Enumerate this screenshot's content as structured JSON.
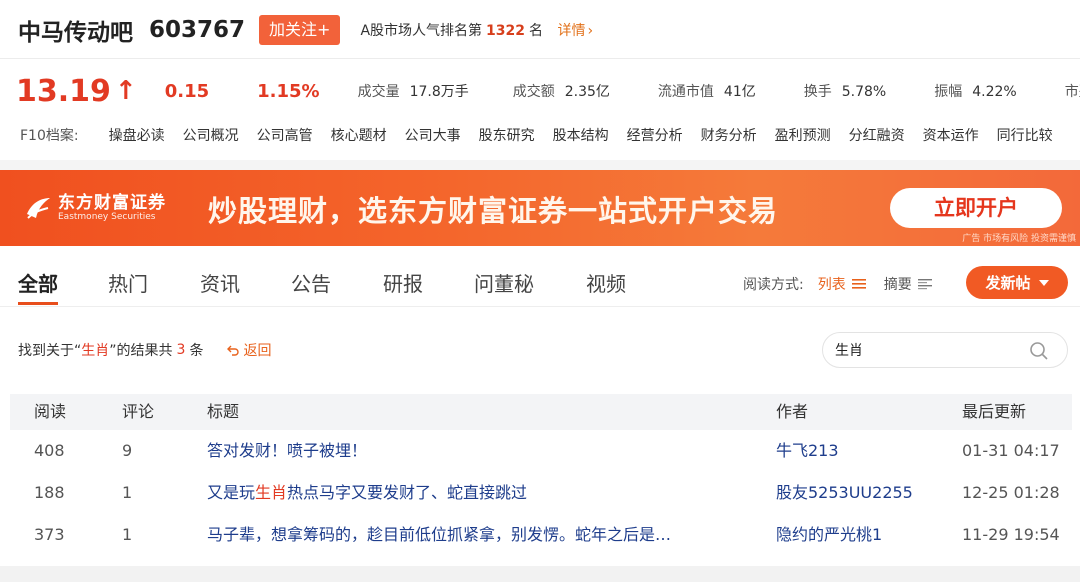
{
  "header": {
    "stock_name": "中马传动吧",
    "stock_code": "603767",
    "follow_label": "加关注+",
    "rank_prefix": "A股市场人气排名第",
    "rank_value": "1322",
    "rank_suffix": "名",
    "detail_label": "详情",
    "detail_icon": "chevron-right-icon"
  },
  "quote": {
    "price": "13.19",
    "direction_icon": "arrow-up-icon",
    "change": "0.15",
    "change_pct": "1.15%",
    "up_color": "#e23a23",
    "stats": [
      {
        "label": "成交量",
        "value": "17.8万手"
      },
      {
        "label": "成交额",
        "value": "2.35亿"
      },
      {
        "label": "流通市值",
        "value": "41亿"
      },
      {
        "label": "换手",
        "value": "5.78%"
      },
      {
        "label": "振幅",
        "value": "4.22%"
      },
      {
        "label": "市盈",
        "value": ""
      }
    ]
  },
  "f10": {
    "label": "F10档案:",
    "items": [
      "操盘必读",
      "公司概况",
      "公司高管",
      "核心题材",
      "公司大事",
      "股东研究",
      "股本结构",
      "经营分析",
      "财务分析",
      "盈利预测",
      "分红融资",
      "资本运作",
      "同行比较"
    ]
  },
  "banner": {
    "logo_cn": "东方财富证券",
    "logo_en": "Eastmoney Securities",
    "slogan": "炒股理财，选东方财富证券一站式开户交易",
    "cta": "立即开户",
    "note": "广告  市场有风险 投资需谨慎"
  },
  "tabs": {
    "items": [
      "全部",
      "热门",
      "资讯",
      "公告",
      "研报",
      "问董秘",
      "视频"
    ],
    "active_index": 0,
    "read_mode_label": "阅读方式:",
    "mode_list": "列表",
    "mode_summary": "摘要",
    "post_button": "发新帖",
    "accent": "#f15a24"
  },
  "search_result": {
    "prefix": "找到关于“",
    "keyword": "生肖",
    "middle": "”的结果共",
    "count": "3",
    "suffix": "条",
    "back_label": "返回"
  },
  "search": {
    "value": "生肖",
    "icon": "search-icon"
  },
  "table": {
    "headers": [
      "阅读",
      "评论",
      "标题",
      "作者",
      "最后更新"
    ],
    "rows": [
      {
        "reads": "408",
        "comments": "9",
        "title_pre": "答对发财！喷子被埋！",
        "title_hl": "",
        "title_post": "",
        "author": "牛飞213",
        "time": "01-31 04:17"
      },
      {
        "reads": "188",
        "comments": "1",
        "title_pre": "又是玩",
        "title_hl": "生肖",
        "title_post": "热点马字又要发财了、蛇直接跳过",
        "author": "股友5253UU2255",
        "time": "12-25 01:28"
      },
      {
        "reads": "373",
        "comments": "1",
        "title_pre": "马子辈，想拿筹码的，趁目前低位抓紧拿，别发愣。蛇年之后是…",
        "title_hl": "",
        "title_post": "",
        "author": "隐约的严光桃1",
        "time": "11-29 19:54"
      }
    ]
  }
}
